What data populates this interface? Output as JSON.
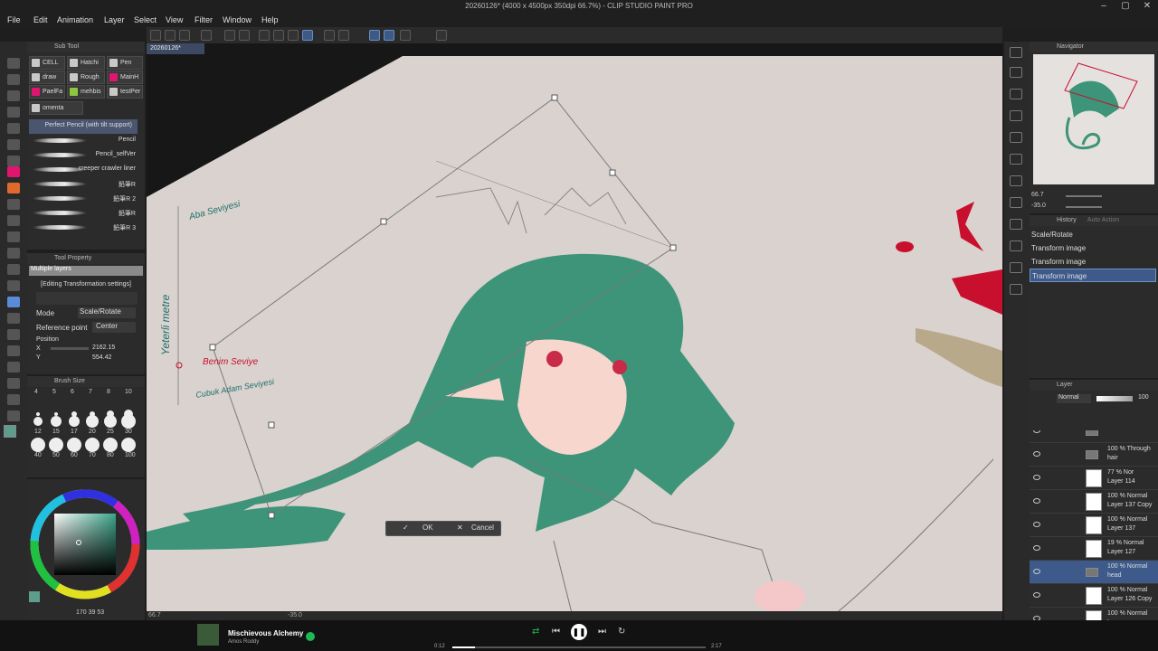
{
  "window": {
    "title": "20260126* (4000 x 4500px 350dpi 66.7%) - CLIP STUDIO PAINT PRO",
    "menu": [
      "File",
      "Edit",
      "Animation",
      "Layer",
      "Select",
      "View",
      "Filter",
      "Window",
      "Help"
    ]
  },
  "subtool_panel": {
    "header": "Sub Tool",
    "tabs": [
      {
        "label": "CELL",
        "color": "#c8c8c8"
      },
      {
        "label": "Hatchi",
        "color": "#c8c8c8"
      },
      {
        "label": "Pen",
        "color": "#c8c8c8"
      },
      {
        "label": "draw",
        "color": "#c8c8c8"
      },
      {
        "label": "Rough",
        "color": "#c8c8c8"
      },
      {
        "label": "MainH",
        "color": "#e0156f"
      },
      {
        "label": "PaelFa",
        "color": "#e0156f"
      },
      {
        "label": "mehbis",
        "color": "#8dc63f"
      },
      {
        "label": "testPer",
        "color": "#c8c8c8"
      },
      {
        "label": "omenta",
        "color": "#c8c8c8"
      }
    ],
    "brushes": [
      "Perfect Pencil (with tilt support)",
      "Pencil",
      "Pencil_selfVer",
      "creeper crawler liner",
      "鉛筆R",
      "鉛筆R 2",
      "鉛筆R",
      "鉛筆R 3"
    ]
  },
  "tool_property": {
    "header": "Tool Property",
    "group": "Multiple layers",
    "subtitle": "[Editing Transformation settings]",
    "mode_label": "Mode",
    "mode_value": "Scale/Rotate",
    "ref_label": "Reference point",
    "ref_value": "Center",
    "position_label": "Position",
    "x_label": "X",
    "x_value": "2162.15",
    "y_label": "Y",
    "y_value": "554.42"
  },
  "brush_size": {
    "header": "Brush Size",
    "row1": [
      "4",
      "5",
      "6",
      "7",
      "8",
      "10"
    ],
    "row2": [
      "12",
      "15",
      "17",
      "20",
      "25",
      "30"
    ],
    "row3": [
      "40",
      "50",
      "60",
      "70",
      "80",
      "100"
    ]
  },
  "color_panel": {
    "footer": "170 39 53"
  },
  "canvas": {
    "doc_tab": "20260126*",
    "annotations": {
      "top": "Aba Seviyesi",
      "side": "Yeterli metre",
      "mid": "Benim Seviye",
      "bottom": "Cubuk Adam Seviyesi"
    },
    "ok_label": "OK",
    "cancel_label": "Cancel",
    "zoom": "66.7",
    "angle": "-35.0",
    "colors": {
      "bg": "#d9d2cf",
      "hair": "#3d9479",
      "skin": "#f7d6ce",
      "eye": "#c82a48",
      "red_mark": "#c8102e",
      "teal_ink": "#1f6f6a"
    }
  },
  "navigator": {
    "header": "Navigator",
    "zoom": "66.7",
    "angle": "-35.0"
  },
  "history": {
    "header": "History",
    "tab2": "Auto Action",
    "items": [
      "Scale/Rotate",
      "Transform image",
      "Transform image",
      "Transform image"
    ],
    "selected": 3
  },
  "layers": {
    "header": "Layer",
    "blend": "Normal",
    "opacity": "100",
    "rows": [
      {
        "l1": "sketch",
        "l2": "",
        "selected": false,
        "folder": true
      },
      {
        "l1": "100 % Through",
        "l2": "hair",
        "selected": false,
        "folder": true
      },
      {
        "l1": "77 % Nor",
        "l2": "Layer 114",
        "selected": false,
        "folder": false
      },
      {
        "l1": "100 % Normal",
        "l2": "Layer 137 Copy",
        "selected": false,
        "folder": false
      },
      {
        "l1": "100 % Normal",
        "l2": "Layer 137",
        "selected": false,
        "folder": false
      },
      {
        "l1": "19 % Normal",
        "l2": "Layer 127",
        "selected": false,
        "folder": false
      },
      {
        "l1": "100 % Normal",
        "l2": "head",
        "selected": true,
        "folder": true
      },
      {
        "l1": "100 % Normal",
        "l2": "Layer 126 Copy",
        "selected": false,
        "folder": false
      },
      {
        "l1": "100 % Normal",
        "l2": "Layer ...",
        "selected": false,
        "folder": false
      }
    ]
  },
  "player": {
    "track": "Mischievous Alchemy",
    "artist": "Amos Roddy",
    "elapsed": "0:12",
    "total": "2:17",
    "progress": 0.088
  }
}
